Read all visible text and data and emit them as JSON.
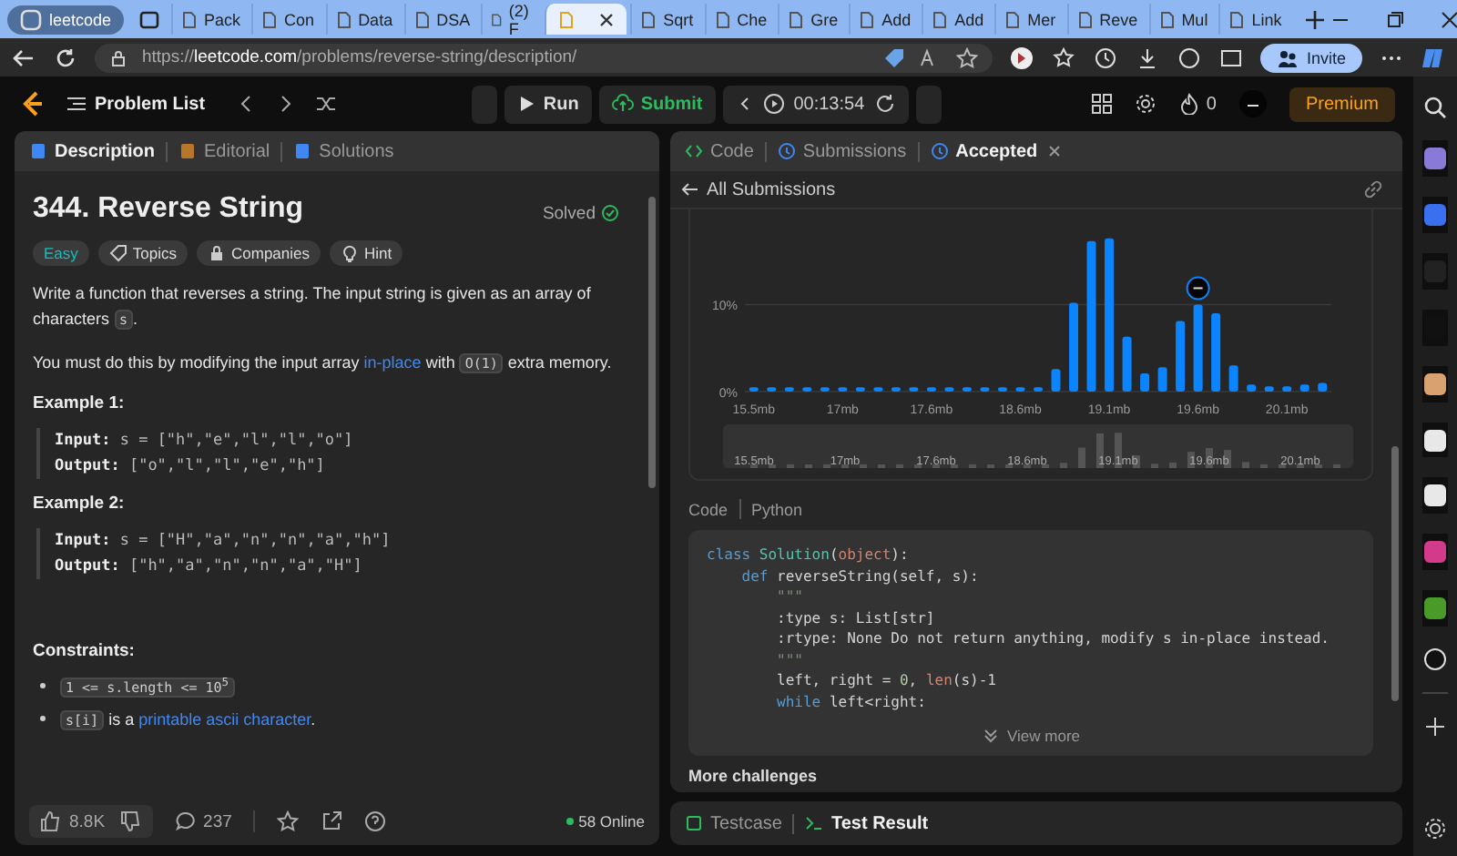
{
  "browser": {
    "profile": "leetcode",
    "tabs": [
      {
        "label": "Pack",
        "selected": false
      },
      {
        "label": "Con",
        "selected": false
      },
      {
        "label": "Data",
        "selected": false
      },
      {
        "label": "DSA",
        "selected": false
      },
      {
        "label": "(2) F",
        "selected": false
      },
      {
        "selected": true
      },
      {
        "label": "Sqrt",
        "selected": false
      },
      {
        "label": "Che",
        "selected": false
      },
      {
        "label": "Gre",
        "selected": false
      },
      {
        "label": "Add",
        "selected": false
      },
      {
        "label": "Add",
        "selected": false
      },
      {
        "label": "Mer",
        "selected": false
      },
      {
        "label": "Reve",
        "selected": false
      },
      {
        "label": "Mul",
        "selected": false
      },
      {
        "label": "Link",
        "selected": false
      }
    ],
    "url_scheme": "https://",
    "url_domain": "leetcode.com",
    "url_path": "/problems/reverse-string/description/",
    "invite": "Invite"
  },
  "nav": {
    "problem_list": "Problem List",
    "run": "Run",
    "submit": "Submit",
    "timer": "00:13:54",
    "streak": "0",
    "premium": "Premium"
  },
  "description": {
    "tabs": [
      {
        "label": "Description",
        "selected": true
      },
      {
        "label": "Editorial",
        "selected": false
      },
      {
        "label": "Solutions",
        "selected": false
      }
    ],
    "title": "344. Reverse String",
    "status": "Solved",
    "tags": [
      {
        "label": "Easy",
        "kind": "difficulty"
      },
      {
        "label": "Topics",
        "kind": "topics"
      },
      {
        "label": "Companies",
        "kind": "companies"
      },
      {
        "label": "Hint",
        "kind": "hint"
      }
    ],
    "paragraphs": [
      [
        {
          "kind": "text",
          "text": "Write a function that reverses a string. The input string is given as an array of characters "
        },
        {
          "kind": "code",
          "text": "s"
        },
        {
          "kind": "text",
          "text": "."
        }
      ],
      [
        {
          "kind": "text",
          "text": "You must do this by modifying the input array "
        },
        {
          "kind": "link",
          "text": "in-place"
        },
        {
          "kind": "text",
          "text": " with "
        },
        {
          "kind": "code",
          "text": "O(1)"
        },
        {
          "kind": "text",
          "text": " extra memory."
        }
      ]
    ],
    "examples": [
      {
        "title": "Example 1:",
        "input_label": "Input:",
        "input": "s = [\"h\",\"e\",\"l\",\"l\",\"o\"]",
        "output_label": "Output:",
        "output": "[\"o\",\"l\",\"l\",\"e\",\"h\"]"
      },
      {
        "title": "Example 2:",
        "input_label": "Input:",
        "input": "s = [\"H\",\"a\",\"n\",\"n\",\"a\",\"h\"]",
        "output_label": "Output:",
        "output": "[\"h\",\"a\",\"n\",\"n\",\"a\",\"H\"]"
      }
    ],
    "constraints_title": "Constraints:",
    "constraints": [
      [
        {
          "kind": "code",
          "text": "1 <= s.length <= 10$^{5}$"
        }
      ],
      [
        {
          "kind": "code",
          "text": "s[i]"
        },
        {
          "kind": "text",
          "text": " is a "
        },
        {
          "kind": "link",
          "text": "printable ascii character"
        },
        {
          "kind": "text",
          "text": "."
        }
      ]
    ],
    "likes": "8.8K",
    "comments": "237",
    "online": "58 Online"
  },
  "submission": {
    "tabs": [
      {
        "label": "Code",
        "selected": false,
        "kind": "code"
      },
      {
        "label": "Submissions",
        "selected": false,
        "kind": "submissions"
      },
      {
        "label": "Accepted",
        "selected": true,
        "kind": "accepted"
      }
    ],
    "back": "All Submissions",
    "chart_data": {
      "type": "bar",
      "categories": [
        "15.5mb",
        null,
        null,
        null,
        null,
        "17mb",
        null,
        null,
        null,
        null,
        "17.6mb",
        null,
        null,
        null,
        null,
        "18.6mb",
        null,
        null,
        null,
        null,
        "19.1mb",
        null,
        null,
        null,
        null,
        "19.6mb",
        null,
        null,
        null,
        null,
        "20.1mb",
        null,
        null
      ],
      "values": [
        0.5,
        0.5,
        0.5,
        0.5,
        0.5,
        0.5,
        0.5,
        0.5,
        0.5,
        0.5,
        0.5,
        0.5,
        0.5,
        0.5,
        0.5,
        0.5,
        0.5,
        2.6,
        10.2,
        17.3,
        17.6,
        6.3,
        2.1,
        2.8,
        8.1,
        10,
        9,
        3,
        0.8,
        0.6,
        0.6,
        0.8,
        1.0
      ],
      "ylim": [
        0,
        18
      ],
      "yticks": [
        {
          "value": 0,
          "label": "0%"
        },
        {
          "value": 10,
          "label": "10%"
        }
      ],
      "annotations": [
        {
          "x": "19.6mb"
        }
      ]
    },
    "navigator_labels": [
      "15.5mb",
      "17mb",
      "17.6mb",
      "18.6mb",
      "19.1mb",
      "19.6mb",
      "20.1mb"
    ],
    "code_label": "Code",
    "language": "Python",
    "code": [
      [
        {
          "kind": "keyword",
          "text": "class "
        },
        {
          "kind": "classname",
          "text": "Solution"
        },
        {
          "kind": "plain",
          "text": "("
        },
        {
          "kind": "builtin",
          "text": "object"
        },
        {
          "kind": "plain",
          "text": "):"
        }
      ],
      [
        {
          "kind": "keyword",
          "text": "    def "
        },
        {
          "kind": "plain",
          "text": "reverseString(self, s):"
        }
      ],
      [
        {
          "kind": "string",
          "text": "        \"\"\""
        }
      ],
      [
        {
          "kind": "plain",
          "text": "        :type s: List[str]"
        }
      ],
      [
        {
          "kind": "plain",
          "text": "        :rtype: None Do not return anything, modify s in-place instead."
        }
      ],
      [
        {
          "kind": "string",
          "text": "        \"\"\""
        }
      ],
      [
        {
          "kind": "plain",
          "text": "        left, right = "
        },
        {
          "kind": "number",
          "text": "0"
        },
        {
          "kind": "plain",
          "text": ", "
        },
        {
          "kind": "builtin",
          "text": "len"
        },
        {
          "kind": "plain",
          "text": "(s)-1"
        }
      ],
      [
        {
          "kind": "keyword",
          "text": "        while "
        },
        {
          "kind": "plain",
          "text": "left<right:"
        }
      ]
    ],
    "view_more": "View more",
    "more": "More challenges"
  },
  "console": {
    "tabs": [
      {
        "label": "Testcase",
        "selected": false
      },
      {
        "label": "Test Result",
        "selected": true
      }
    ]
  }
}
